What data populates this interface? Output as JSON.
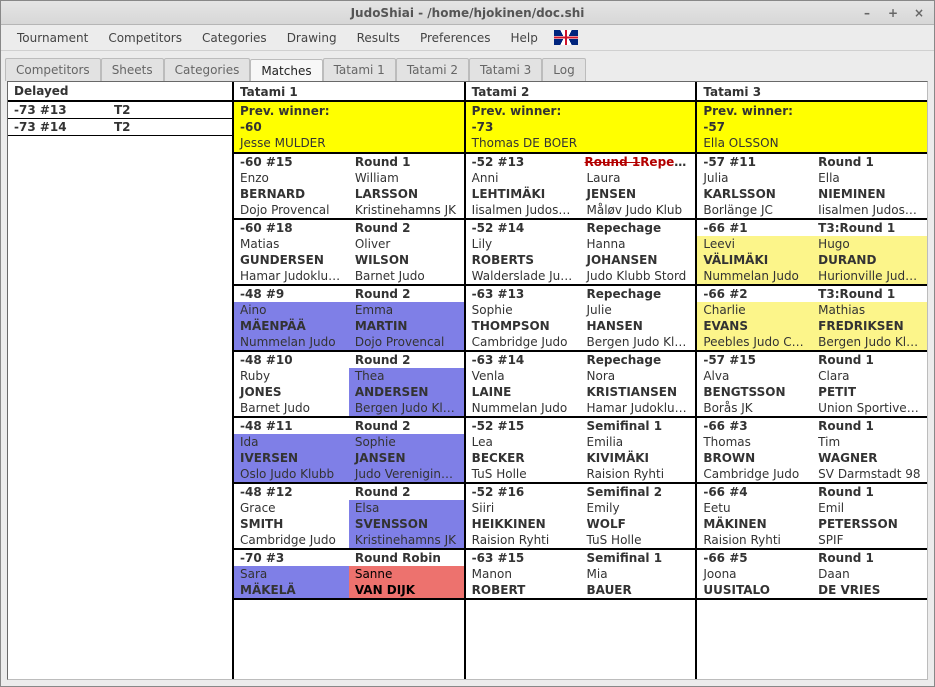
{
  "window": {
    "title": "JudoShiai - /home/hjokinen/doc.shi"
  },
  "menu": {
    "items": [
      "Tournament",
      "Competitors",
      "Categories",
      "Drawing",
      "Results",
      "Preferences",
      "Help"
    ]
  },
  "tabs": {
    "items": [
      "Competitors",
      "Sheets",
      "Categories",
      "Matches",
      "Tatami 1",
      "Tatami 2",
      "Tatami 3",
      "Log"
    ],
    "active": "Matches"
  },
  "delayed": {
    "header": "Delayed",
    "rows": [
      {
        "cat": "-73 #13",
        "tatami": "T2"
      },
      {
        "cat": "-73 #14",
        "tatami": "T2"
      }
    ]
  },
  "tatamis": [
    {
      "title": "Tatami 1",
      "prev": {
        "label": "Prev. winner:",
        "cat": "-60",
        "name": "Jesse MULDER"
      },
      "matches": [
        {
          "header": "-60 #15",
          "round": "Round 1",
          "leftBg": "white",
          "rightBg": "white",
          "l_first": "Enzo",
          "l_last": "BERNARD",
          "l_club": "Dojo Provencal",
          "r_first": "William",
          "r_last": "LARSSON",
          "r_club": "Kristinehamns JK"
        },
        {
          "header": "-60 #18",
          "round": "Round 2",
          "leftBg": "white",
          "rightBg": "white",
          "l_first": "Matias",
          "l_last": "GUNDERSEN",
          "l_club": "Hamar Judoklubb",
          "r_first": "Oliver",
          "r_last": "WILSON",
          "r_club": "Barnet Judo"
        },
        {
          "header": "-48 #9",
          "round": "Round 2",
          "leftBg": "blue",
          "rightBg": "blue",
          "l_first": "Aino",
          "l_last": "MÄENPÄÄ",
          "l_club": "Nummelan Judo",
          "r_first": "Emma",
          "r_last": "MARTIN",
          "r_club": "Dojo Provencal"
        },
        {
          "header": "-48 #10",
          "round": "Round 2",
          "leftBg": "white",
          "rightBg": "blue",
          "l_first": "Ruby",
          "l_last": "JONES",
          "l_club": "Barnet Judo",
          "r_first": "Thea",
          "r_last": "ANDERSEN",
          "r_club": "Bergen Judo Klubb"
        },
        {
          "header": "-48 #11",
          "round": "Round 2",
          "leftBg": "blue",
          "rightBg": "blue",
          "l_first": "Ida",
          "l_last": "IVERSEN",
          "l_club": "Oslo Judo Klubb",
          "r_first": "Sophie",
          "r_last": "JANSEN",
          "r_club": "Judo Vereniging M"
        },
        {
          "header": "-48 #12",
          "round": "Round 2",
          "leftBg": "white",
          "rightBg": "blue",
          "l_first": "Grace",
          "l_last": "SMITH",
          "l_club": "Cambridge Judo",
          "r_first": "Elsa",
          "r_last": "SVENSSON",
          "r_club": "Kristinehamns JK"
        },
        {
          "header": "-70 #3",
          "round": "Round Robin",
          "leftBg": "blue",
          "rightBg": "red",
          "l_first": "Sara",
          "l_last": "MÄKELÄ",
          "l_club": "",
          "r_first": "Sanne",
          "r_last": "VAN DIJK",
          "r_club": ""
        }
      ]
    },
    {
      "title": "Tatami 2",
      "prev": {
        "label": "Prev. winner:",
        "cat": "-73",
        "name": "Thomas DE BOER"
      },
      "matches": [
        {
          "header": "-52 #13",
          "round": "Repechage",
          "roundMark": "strike",
          "leftBg": "white",
          "rightBg": "white",
          "l_first": "Anni",
          "l_last": "LEHTIMÄKI",
          "l_club": "Iisalmen Judoseura",
          "r_first": "Laura",
          "r_last": "JENSEN",
          "r_club": "Måløv Judo Klub"
        },
        {
          "header": "-52 #14",
          "round": "Repechage",
          "leftBg": "white",
          "rightBg": "white",
          "l_first": "Lily",
          "l_last": "ROBERTS",
          "l_club": "Walderslade Judo",
          "r_first": "Hanna",
          "r_last": "JOHANSEN",
          "r_club": "Judo Klubb Stord"
        },
        {
          "header": "-63 #13",
          "round": "Repechage",
          "leftBg": "white",
          "rightBg": "white",
          "l_first": "Sophie",
          "l_last": "THOMPSON",
          "l_club": "Cambridge Judo",
          "r_first": "Julie",
          "r_last": "HANSEN",
          "r_club": "Bergen Judo Klubb"
        },
        {
          "header": "-63 #14",
          "round": "Repechage",
          "leftBg": "white",
          "rightBg": "white",
          "l_first": "Venla",
          "l_last": "LAINE",
          "l_club": "Nummelan Judo",
          "r_first": "Nora",
          "r_last": "KRISTIANSEN",
          "r_club": "Hamar Judoklubb"
        },
        {
          "header": "-52 #15",
          "round": "Semifinal 1",
          "leftBg": "white",
          "rightBg": "white",
          "l_first": "Lea",
          "l_last": "BECKER",
          "l_club": "TuS Holle",
          "r_first": "Emilia",
          "r_last": "KIVIMÄKI",
          "r_club": "Raision Ryhti"
        },
        {
          "header": "-52 #16",
          "round": "Semifinal 2",
          "leftBg": "white",
          "rightBg": "white",
          "l_first": "Siiri",
          "l_last": "HEIKKINEN",
          "l_club": "Raision Ryhti",
          "r_first": "Emily",
          "r_last": "WOLF",
          "r_club": "TuS Holle"
        },
        {
          "header": "-63 #15",
          "round": "Semifinal 1",
          "leftBg": "white",
          "rightBg": "white",
          "l_first": "Manon",
          "l_last": "ROBERT",
          "l_club": "",
          "r_first": "Mia",
          "r_last": "BAUER",
          "r_club": ""
        }
      ]
    },
    {
      "title": "Tatami 3",
      "prev": {
        "label": "Prev. winner:",
        "cat": "-57",
        "name": "Ella OLSSON"
      },
      "matches": [
        {
          "header": "-57 #11",
          "round": "Round 1",
          "leftBg": "white",
          "rightBg": "white",
          "l_first": "Julia",
          "l_last": "KARLSSON",
          "l_club": "Borlänge JC",
          "r_first": "Ella",
          "r_last": "NIEMINEN",
          "r_club": "Iisalmen Judoseura"
        },
        {
          "header": "-66 #1",
          "round": "T3:Round 1",
          "leftBg": "yellow",
          "rightBg": "yellow",
          "l_first": "Leevi",
          "l_last": "VÄLIMÄKI",
          "l_club": "Nummelan Judo",
          "r_first": "Hugo",
          "r_last": "DURAND",
          "r_club": "Hurionville Judo Cl"
        },
        {
          "header": "-66 #2",
          "round": "T3:Round 1",
          "leftBg": "yellow",
          "rightBg": "yellow",
          "l_first": "Charlie",
          "l_last": "EVANS",
          "l_club": "Peebles Judo Club",
          "r_first": "Mathias",
          "r_last": "FREDRIKSEN",
          "r_club": "Bergen Judo Klubb"
        },
        {
          "header": "-57 #15",
          "round": "Round 1",
          "leftBg": "white",
          "rightBg": "white",
          "l_first": "Alva",
          "l_last": "BENGTSSON",
          "l_club": "Borås JK",
          "r_first": "Clara",
          "r_last": "PETIT",
          "r_club": "Union Sportive Bo"
        },
        {
          "header": "-66 #3",
          "round": "Round 1",
          "leftBg": "white",
          "rightBg": "white",
          "l_first": "Thomas",
          "l_last": "BROWN",
          "l_club": "Cambridge Judo",
          "r_first": "Tim",
          "r_last": "WAGNER",
          "r_club": "SV Darmstadt 98"
        },
        {
          "header": "-66 #4",
          "round": "Round 1",
          "leftBg": "white",
          "rightBg": "white",
          "l_first": "Eetu",
          "l_last": "MÄKINEN",
          "l_club": "Raision Ryhti",
          "r_first": "Emil",
          "r_last": "PETERSSON",
          "r_club": "SPIF"
        },
        {
          "header": "-66 #5",
          "round": "Round 1",
          "leftBg": "white",
          "rightBg": "white",
          "l_first": "Joona",
          "l_last": "UUSITALO",
          "l_club": "",
          "r_first": "Daan",
          "r_last": "DE VRIES",
          "r_club": ""
        }
      ]
    }
  ]
}
